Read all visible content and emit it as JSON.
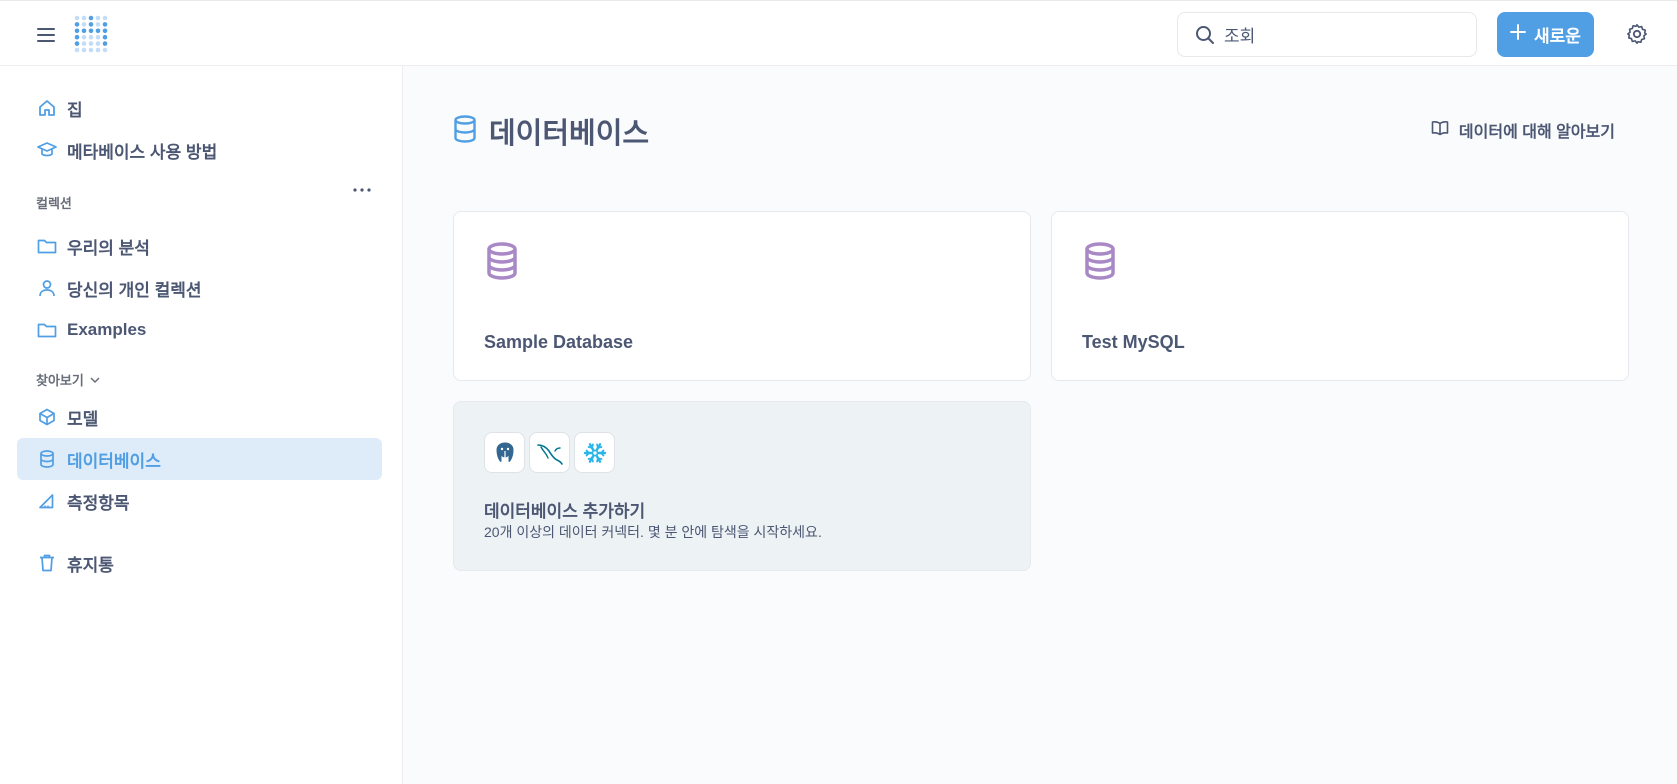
{
  "header": {
    "search_placeholder": "조회",
    "new_button_label": "새로운"
  },
  "sidebar": {
    "top_items": [
      {
        "label": "집",
        "icon": "home-icon"
      },
      {
        "label": "메타베이스 사용 방법",
        "icon": "graduation-cap-icon"
      }
    ],
    "collections_title": "컬렉션",
    "collections": [
      {
        "label": "우리의 분석",
        "icon": "folder-icon"
      },
      {
        "label": "당신의 개인 컬렉션",
        "icon": "person-icon"
      },
      {
        "label": "Examples",
        "icon": "folder-icon"
      }
    ],
    "browse_title": "찾아보기",
    "browse": [
      {
        "label": "모델",
        "icon": "cube-icon"
      },
      {
        "label": "데이터베이스",
        "icon": "database-icon",
        "active": true
      },
      {
        "label": "측정항목",
        "icon": "ruler-icon"
      }
    ],
    "trash_label": "휴지통"
  },
  "main": {
    "title": "데이터베이스",
    "learn_link": "데이터에 대해 알아보기",
    "databases": [
      {
        "name": "Sample Database"
      },
      {
        "name": "Test MySQL"
      }
    ],
    "add_card": {
      "title": "데이터베이스 추가하기",
      "subtitle": "20개 이상의 데이터 커넥터. 몇 분 안에 탐색을 시작하세요.",
      "logos": [
        "postgresql-logo-icon",
        "mysql-logo-icon",
        "snowflake-logo-icon"
      ]
    }
  },
  "colors": {
    "brand": "#509ee3",
    "db_icon": "#a989c5",
    "active_bg": "#deecf9",
    "text": "#4c5773"
  }
}
